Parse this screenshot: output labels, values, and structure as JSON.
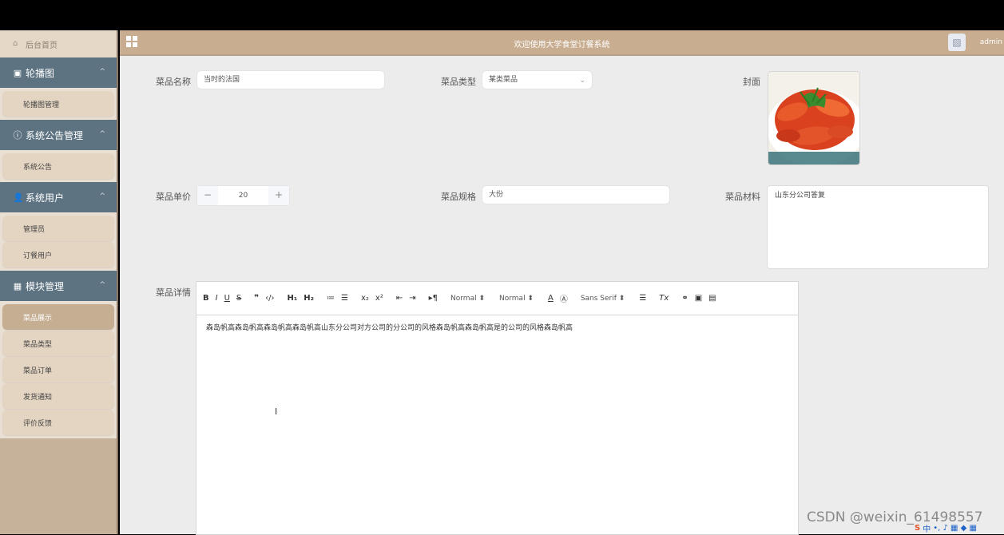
{
  "header": {
    "title": "欢迎使用大学食堂订餐系统",
    "user": "admin"
  },
  "sidebar": {
    "home": "后台首页",
    "groups": [
      {
        "label": "轮播图",
        "items": [
          "轮播图管理"
        ]
      },
      {
        "label": "系统公告管理",
        "items": [
          "系统公告"
        ]
      },
      {
        "label": "系统用户",
        "items": [
          "管理员",
          "订餐用户"
        ]
      },
      {
        "label": "模块管理",
        "items": [
          "菜品展示",
          "菜品类型",
          "菜品订单",
          "发货通知",
          "评价反馈"
        ]
      }
    ]
  },
  "form": {
    "name_label": "菜品名称",
    "name_value": "当时的法国",
    "type_label": "菜品类型",
    "type_value": "某类菜品",
    "cover_label": "封面",
    "price_label": "菜品单价",
    "price_value": "20",
    "price_minus": "−",
    "price_plus": "+",
    "spec_label": "菜品规格",
    "spec_value": "大份",
    "material_label": "菜品材料",
    "material_value": "山东分公司答复",
    "detail_label": "菜品详情",
    "detail_value": "森岛帆高森岛帆高森岛帆高森岛帆高山东分公司对方公司的分公司的风格森岛帆高森岛帆高是的公司的风格森岛帆高"
  },
  "editor_toolbar": {
    "bold": "B",
    "italic": "I",
    "underline": "U",
    "strike": "S",
    "quote": "❞",
    "code": "‹/›",
    "h1": "H₁",
    "h2": "H₂",
    "ol": "≔",
    "ul": "☰",
    "sub": "x₂",
    "sup": "x²",
    "outdent": "⇤",
    "indent": "⇥",
    "direction": "▸¶",
    "size": "Normal ⬍",
    "header": "Normal ⬍",
    "color": "A",
    "bg": "Ⓐ",
    "font": "Sans Serif ⬍",
    "align": "☰",
    "clean": "Tx",
    "link": "⚭",
    "image": "▣",
    "video": "▤"
  },
  "watermark": "CSDN @weixin_61498557",
  "tray": {
    "ime": "S",
    "lang": "中",
    "items": "•, ♪ ▦ ◆ ▦"
  }
}
